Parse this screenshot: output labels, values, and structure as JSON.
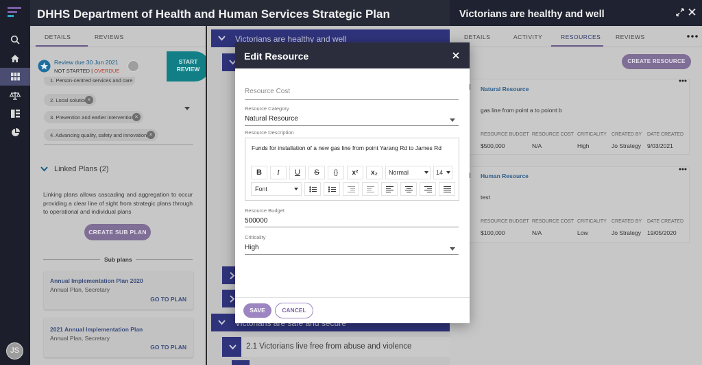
{
  "app": {
    "title": "DHHS Department of Health and Human Services Strategic Plan"
  },
  "rail": {
    "icons": [
      "logo-icon",
      "search-icon",
      "home-icon",
      "grid-icon",
      "scales-icon",
      "book-icon",
      "pie-chart-icon"
    ],
    "avatar": "JS"
  },
  "left": {
    "tabs": [
      "DETAILS",
      "REVIEWS"
    ],
    "review": {
      "due": "Review due 30 Jun 2021",
      "status": "NOT STARTED",
      "separator": " | ",
      "overdue": "OVERDUE",
      "start_label": "START\nREVIEW"
    },
    "chips": [
      "1. Person-centred services and care",
      "2. Local solutions",
      "3. Prevention and earlier intervention",
      "4. Advancing quality, safety and innovation"
    ],
    "linked_plans_title": "Linked Plans (2)",
    "linked_desc": "Linking plans allows cascading and aggregation to occur providing a clear line of sight from strategic plans through to operational and individual plans",
    "create_sub_plan": "CREATE SUB PLAN",
    "sub_plans_label": "Sub plans",
    "sub_plans": [
      {
        "title": "Annual Implementation Plan 2020",
        "subtitle": "Annual Plan, Secretary",
        "action": "GO TO PLAN"
      },
      {
        "title": "2021 Annual Implementation Plan",
        "subtitle": "Annual Plan, Secretary",
        "action": "GO TO PLAN"
      }
    ]
  },
  "middle": {
    "group1": "Victorians are healthy and well",
    "group2": "Victorians are safe and secure",
    "item21": "2.1 Victorians live free from abuse and violence"
  },
  "right": {
    "title": "Victorians are healthy and well",
    "tabs": [
      "DETAILS",
      "ACTIVITY",
      "RESOURCES",
      "REVIEWS"
    ],
    "active_tab": "RESOURCES",
    "create_resource": "CREATE RESOURCE",
    "col_labels": [
      "RESOURCE BUDGET",
      "RESOURCE COST",
      "CRITICALITY",
      "CREATED BY",
      "DATE CREATED"
    ],
    "resources": [
      {
        "title": "Natural Resource",
        "desc": "gas line from point a to poiont b",
        "values": [
          "$500,000",
          "N/A",
          "High",
          "Jo Strategy",
          "9/03/2021"
        ]
      },
      {
        "title": "Human Resource",
        "desc": "test",
        "values": [
          "$100,000",
          "N/A",
          "Low",
          "Jo Strategy",
          "19/05/2020"
        ]
      }
    ]
  },
  "modal": {
    "title": "Edit Resource",
    "cost_placeholder": "Resource Cost",
    "category_label": "Resource Category",
    "category_value": "Natural Resource",
    "description_label": "Resource Description",
    "description_value": "Funds for installation of a new gas line from point Yarang Rd to James Rd",
    "toolbar": {
      "bold": "B",
      "italic": "I",
      "underline": "U",
      "strike": "S",
      "code": "{}",
      "sup": "x²",
      "sub": "x₂",
      "format": "Normal",
      "size": "14",
      "font": "Font"
    },
    "budget_label": "Resource Budget",
    "budget_value": "500000",
    "criticality_label": "Criticality",
    "criticality_value": "High",
    "save": "SAVE",
    "cancel": "CANCEL"
  },
  "colors": {
    "accent": "#7b5fa8",
    "navy": "#2f337b",
    "teal": "#127f86",
    "overdue": "#c0392b"
  }
}
